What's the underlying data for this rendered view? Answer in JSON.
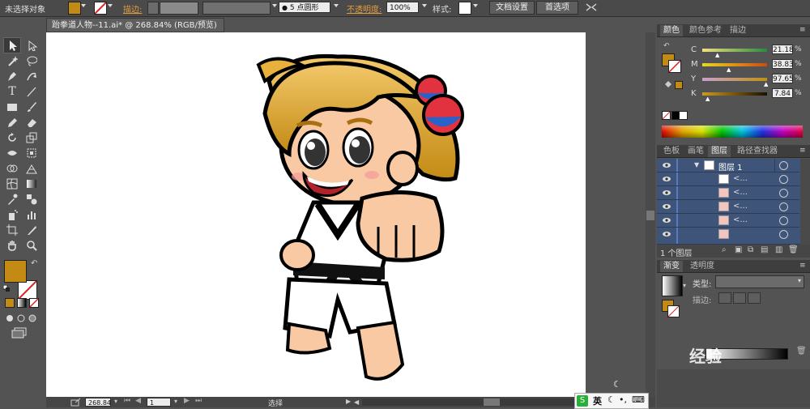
{
  "control_bar": {
    "no_selection": "未选择对象",
    "stroke_label": "描边:",
    "brush_label": "5 点圆形",
    "opacity_label": "不透明度:",
    "opacity_value": "100%",
    "style_label": "样式:",
    "doc_setup_button": "文档设置",
    "preferences_button": "首选项",
    "fill_color": "#c38a14"
  },
  "document": {
    "tab_title": "跆拳道人物--11.ai* @ 268.84% (RGB/预览)"
  },
  "color_panel": {
    "tabs": [
      "颜色",
      "颜色参考",
      "描边"
    ],
    "channels": [
      {
        "name": "C",
        "value": "21.18"
      },
      {
        "name": "M",
        "value": "38.83"
      },
      {
        "name": "Y",
        "value": "97.65"
      },
      {
        "name": "K",
        "value": "7.84"
      }
    ]
  },
  "layers_panel": {
    "tabs": [
      "色板",
      "画笔",
      "图层",
      "路径查找器"
    ],
    "layer_name": "图层 1",
    "sublayer_label": "<...",
    "footer_count": "1 个图层"
  },
  "gradient_panel": {
    "tabs": [
      "渐变",
      "透明度"
    ],
    "type_label": "类型:",
    "stroke_label": "描边:"
  },
  "status_bar": {
    "zoom": "268.84",
    "page": "1",
    "tool_name": "选择"
  },
  "ime": {
    "lang": "英"
  },
  "watermark": {
    "text": "经验"
  }
}
